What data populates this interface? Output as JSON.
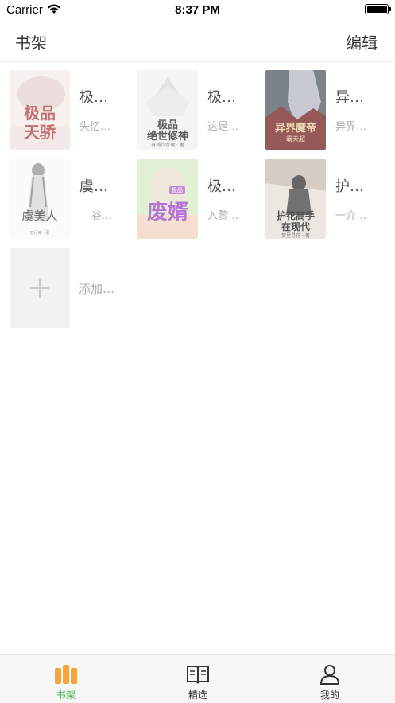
{
  "status_bar": {
    "carrier": "Carrier",
    "time": "8:37 PM"
  },
  "nav": {
    "title": "书架",
    "edit_label": "编辑"
  },
  "books": [
    {
      "title": "极…",
      "desc": "失忆…",
      "cover_text_1": "极品",
      "cover_text_2": "天骄"
    },
    {
      "title": "极…",
      "desc": "这是…",
      "cover_text_1": "极品",
      "cover_text_2": "绝世修神",
      "cover_author": "有销饮水瑰 · 著"
    },
    {
      "title": "异…",
      "desc": "异界…",
      "cover_text_1": "异界魔帝",
      "cover_author": "霸天超"
    },
    {
      "title": "虞…",
      "desc": "谷…",
      "cover_text_1": "虞美人",
      "cover_author": "贰月柒 · 著"
    },
    {
      "title": "极…",
      "desc": "入赘…",
      "cover_text_1": "废婿",
      "cover_badge": "极品"
    },
    {
      "title": "护…",
      "desc": "一介…",
      "cover_text_1": "护花高手",
      "cover_text_2": "在现代",
      "cover_author": "梦里寻花 · 著"
    }
  ],
  "add_book": {
    "label": "添加…"
  },
  "tabs": [
    {
      "label": "书架",
      "icon": "bookshelf-icon",
      "active": true
    },
    {
      "label": "精选",
      "icon": "open-book-icon",
      "active": false
    },
    {
      "label": "我的",
      "icon": "person-icon",
      "active": false
    }
  ],
  "colors": {
    "active_tab": "#f0a040",
    "accent_green": "#4caf50"
  }
}
